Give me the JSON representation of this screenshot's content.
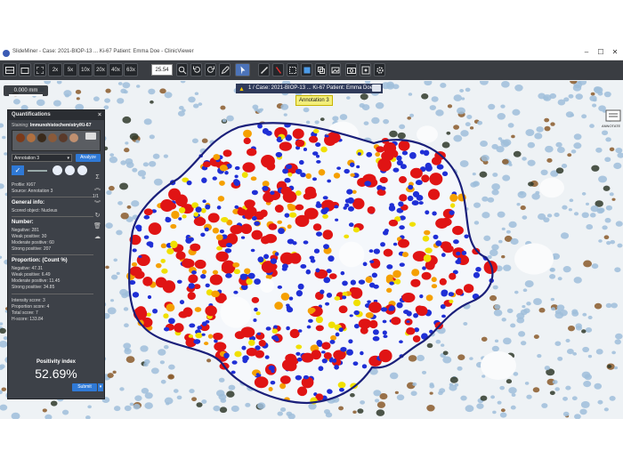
{
  "window": {
    "title": "SlideMiner - Case: 2021-BIOP-13 ... Ki-67 Patient: Emma Doe - ClinicViewer",
    "minimize": "–",
    "maximize": "☐",
    "close": "✕"
  },
  "toolbar": {
    "magnifications": [
      "2x",
      "5x",
      "10x",
      "20x",
      "40x",
      "63x"
    ],
    "one_to_one": "1:1",
    "zoom_value": "25.54"
  },
  "scale": {
    "label": "0.000 mm"
  },
  "case_bar": {
    "text": "1 / Case: 2021-BIOP-13  ... Ki-67 Patient: Emma Doe"
  },
  "annotation_label": "Annotation 3",
  "panel": {
    "title": "Quantifications",
    "close": "×",
    "staining_label": "Staining:",
    "staining_value": "Immunohistochemistry/Ki-67",
    "annotation_select": "Annotation 3",
    "analyze": "Analyze",
    "profile": "Profile: Ki67",
    "source": "Source: Annotation 3",
    "page_indicator": "1/1",
    "general_info_title": "General info:",
    "general_info_value": "Scored object: Nucleus",
    "number_title": "Number:",
    "number_lines": [
      "Negative: 281",
      "Weak positive: 30",
      "Moderate positive: 60",
      "Strong positive: 207"
    ],
    "proportion_title": "Proportion: (Count %)",
    "proportion_lines": [
      "Negative: 47.31",
      "Weak positive: 6.49",
      "Moderate positive: 11.45",
      "Strong positive: 34.85"
    ],
    "score_lines": [
      "Intensity score: 3",
      "Proportion score: 4",
      "Total score: 7",
      "H-score: 133.84"
    ],
    "positivity_label": "Positivity index",
    "positivity_value": "52.69%",
    "submit": "Submit",
    "submit_caret": "▾"
  },
  "right_tool_text": "ANNOTATE",
  "colors": {
    "negative": "#1f2fd6",
    "weak": "#f0e000",
    "moderate": "#f5a000",
    "strong": "#e01414",
    "annotation_outline": "#1a1f7a"
  }
}
